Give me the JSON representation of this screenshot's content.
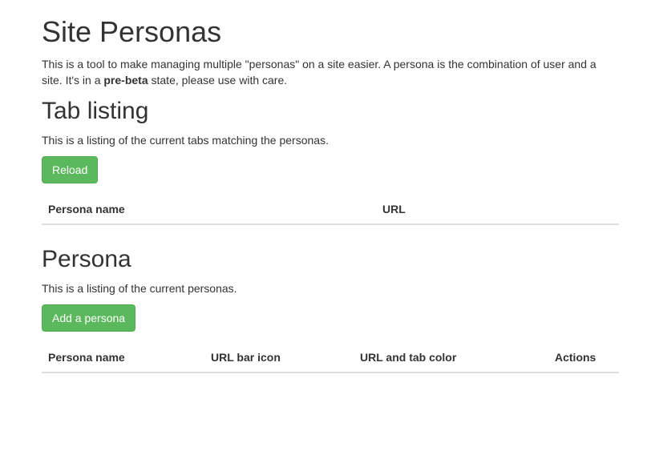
{
  "page": {
    "title": "Site Personas",
    "intro_before": "This is a tool to make managing multiple \"personas\" on a site easier. A persona is the combination of user and a site. It's in a ",
    "intro_bold": "pre-beta",
    "intro_after": " state, please use with care."
  },
  "tabs_section": {
    "title": "Tab listing",
    "description": "This is a listing of the current tabs matching the personas.",
    "reload_label": "Reload",
    "columns": [
      "Persona name",
      "URL"
    ]
  },
  "persona_section": {
    "title": "Persona",
    "description": "This is a listing of the current personas.",
    "add_label": "Add a persona",
    "columns": [
      "Persona name",
      "URL bar icon",
      "URL and tab color",
      "Actions"
    ]
  },
  "colors": {
    "button_success": "#5cb85c",
    "text": "#333333",
    "table_border": "#dddddd"
  }
}
